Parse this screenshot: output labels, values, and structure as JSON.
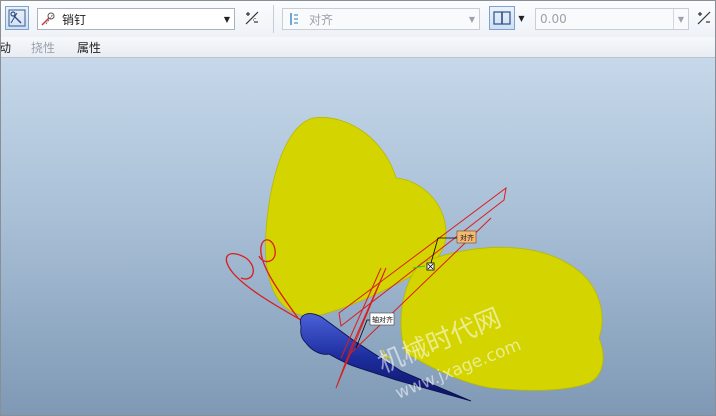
{
  "toolbar": {
    "constraint_type": {
      "value": "销钉",
      "icon": "pin-constraint-icon"
    },
    "secondary_constraint": {
      "placeholder": "对齐",
      "disabled": true
    },
    "offset": {
      "value": "0.00",
      "disabled": true
    }
  },
  "tabs": [
    {
      "label": "动",
      "disabled": false
    },
    {
      "label": "挠性",
      "disabled": true
    },
    {
      "label": "属性",
      "disabled": false
    }
  ],
  "viewport": {
    "tags": {
      "align_top": "对齐",
      "align_bottom": "轴对齐"
    },
    "watermark": {
      "cn": "机械时代网",
      "url": "www.jxage.com"
    },
    "colors": {
      "wings": "#d4d400",
      "body": "#1c2d9e",
      "constraint_lines": "#d81e1e",
      "background_top": "#c6d8ea",
      "background_bottom": "#7f99b5"
    }
  }
}
